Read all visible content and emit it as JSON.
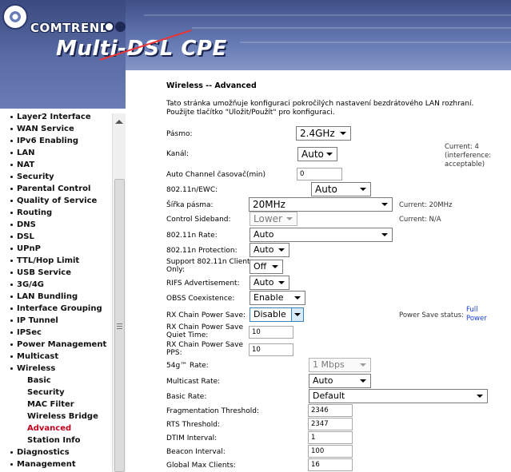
{
  "header": {
    "brand": "COMTREND",
    "product": "Multi-DSL CPE"
  },
  "sidebar": {
    "items": [
      {
        "label": "Layer2 Interface",
        "type": "top"
      },
      {
        "label": "WAN Service",
        "type": "top"
      },
      {
        "label": "IPv6 Enabling",
        "type": "top"
      },
      {
        "label": "LAN",
        "type": "top"
      },
      {
        "label": "NAT",
        "type": "top"
      },
      {
        "label": "Security",
        "type": "top"
      },
      {
        "label": "Parental Control",
        "type": "top"
      },
      {
        "label": "Quality of Service",
        "type": "top"
      },
      {
        "label": "Routing",
        "type": "top"
      },
      {
        "label": "DNS",
        "type": "top"
      },
      {
        "label": "DSL",
        "type": "top"
      },
      {
        "label": "UPnP",
        "type": "top"
      },
      {
        "label": "TTL/Hop Limit",
        "type": "top"
      },
      {
        "label": "USB Service",
        "type": "top"
      },
      {
        "label": "3G/4G",
        "type": "top"
      },
      {
        "label": "LAN Bundling",
        "type": "top"
      },
      {
        "label": "Interface Grouping",
        "type": "top"
      },
      {
        "label": "IP Tunnel",
        "type": "top"
      },
      {
        "label": "IPSec",
        "type": "top"
      },
      {
        "label": "Power Management",
        "type": "top"
      },
      {
        "label": "Multicast",
        "type": "top"
      },
      {
        "label": "Wireless",
        "type": "top"
      },
      {
        "label": "Basic",
        "type": "sub"
      },
      {
        "label": "Security",
        "type": "sub"
      },
      {
        "label": "MAC Filter",
        "type": "sub"
      },
      {
        "label": "Wireless Bridge",
        "type": "sub"
      },
      {
        "label": "Advanced",
        "type": "sub",
        "active": true
      },
      {
        "label": "Station Info",
        "type": "sub"
      },
      {
        "label": "Diagnostics",
        "type": "top"
      },
      {
        "label": "Management",
        "type": "top"
      }
    ]
  },
  "page": {
    "title": "Wireless -- Advanced",
    "description_1": "Tato stránka umožňuje konfiguraci pokročilých nastavení bezdrátového LAN rozhraní.",
    "description_2": "Použijte tlačítko \"Uložit/Použít\" pro konfiguraci."
  },
  "form": {
    "band": {
      "label": "Pásmo:",
      "value": "2.4GHz"
    },
    "channel": {
      "label": "Kanál:",
      "value": "Auto",
      "status_line1": "Current: 4",
      "status_line2": "(interference:",
      "status_line3": "acceptable)"
    },
    "auto_channel_timer": {
      "label": "Auto Channel časovač(min)",
      "value": "0"
    },
    "ewc": {
      "label": "802.11n/EWC:",
      "value": "Auto"
    },
    "bandwidth": {
      "label": "Šířka pásma:",
      "value": "20MHz",
      "status": "Current: 20MHz"
    },
    "control_sideband": {
      "label": "Control Sideband:",
      "value": "Lower",
      "status": "Current: N/A"
    },
    "n_rate": {
      "label": "802.11n Rate:",
      "value": "Auto"
    },
    "n_protection": {
      "label": "802.11n Protection:",
      "value": "Auto"
    },
    "n_client_only": {
      "label_line1": "Support 802.11n Client",
      "label_line2": "Only:",
      "value": "Off"
    },
    "rifs": {
      "label": "RIFS Advertisement:",
      "value": "Auto"
    },
    "obss": {
      "label": "OBSS Coexistence:",
      "value": "Enable"
    },
    "rx_chain_power_save": {
      "label": "RX Chain Power Save:",
      "value": "Disable",
      "status_label": "Power Save status:",
      "status_value_line1": "Full",
      "status_value_line2": "Power"
    },
    "rx_quiet_time": {
      "label_line1": "RX Chain Power Save",
      "label_line2": "Quiet Time:",
      "value": "10"
    },
    "rx_pps": {
      "label_line1": "RX Chain Power Save",
      "label_line2": "PPS:",
      "value": "10"
    },
    "g_rate": {
      "label": "54g™ Rate:",
      "value": "1 Mbps"
    },
    "multicast_rate": {
      "label": "Multicast Rate:",
      "value": "Auto"
    },
    "basic_rate": {
      "label": "Basic Rate:",
      "value": "Default"
    },
    "frag_threshold": {
      "label": "Fragmentation Threshold:",
      "value": "2346"
    },
    "rts_threshold": {
      "label": "RTS Threshold:",
      "value": "2347"
    },
    "dtim": {
      "label": "DTIM Interval:",
      "value": "1"
    },
    "beacon": {
      "label": "Beacon Interval:",
      "value": "100"
    },
    "max_clients": {
      "label": "Global Max Clients:",
      "value": "16"
    }
  }
}
